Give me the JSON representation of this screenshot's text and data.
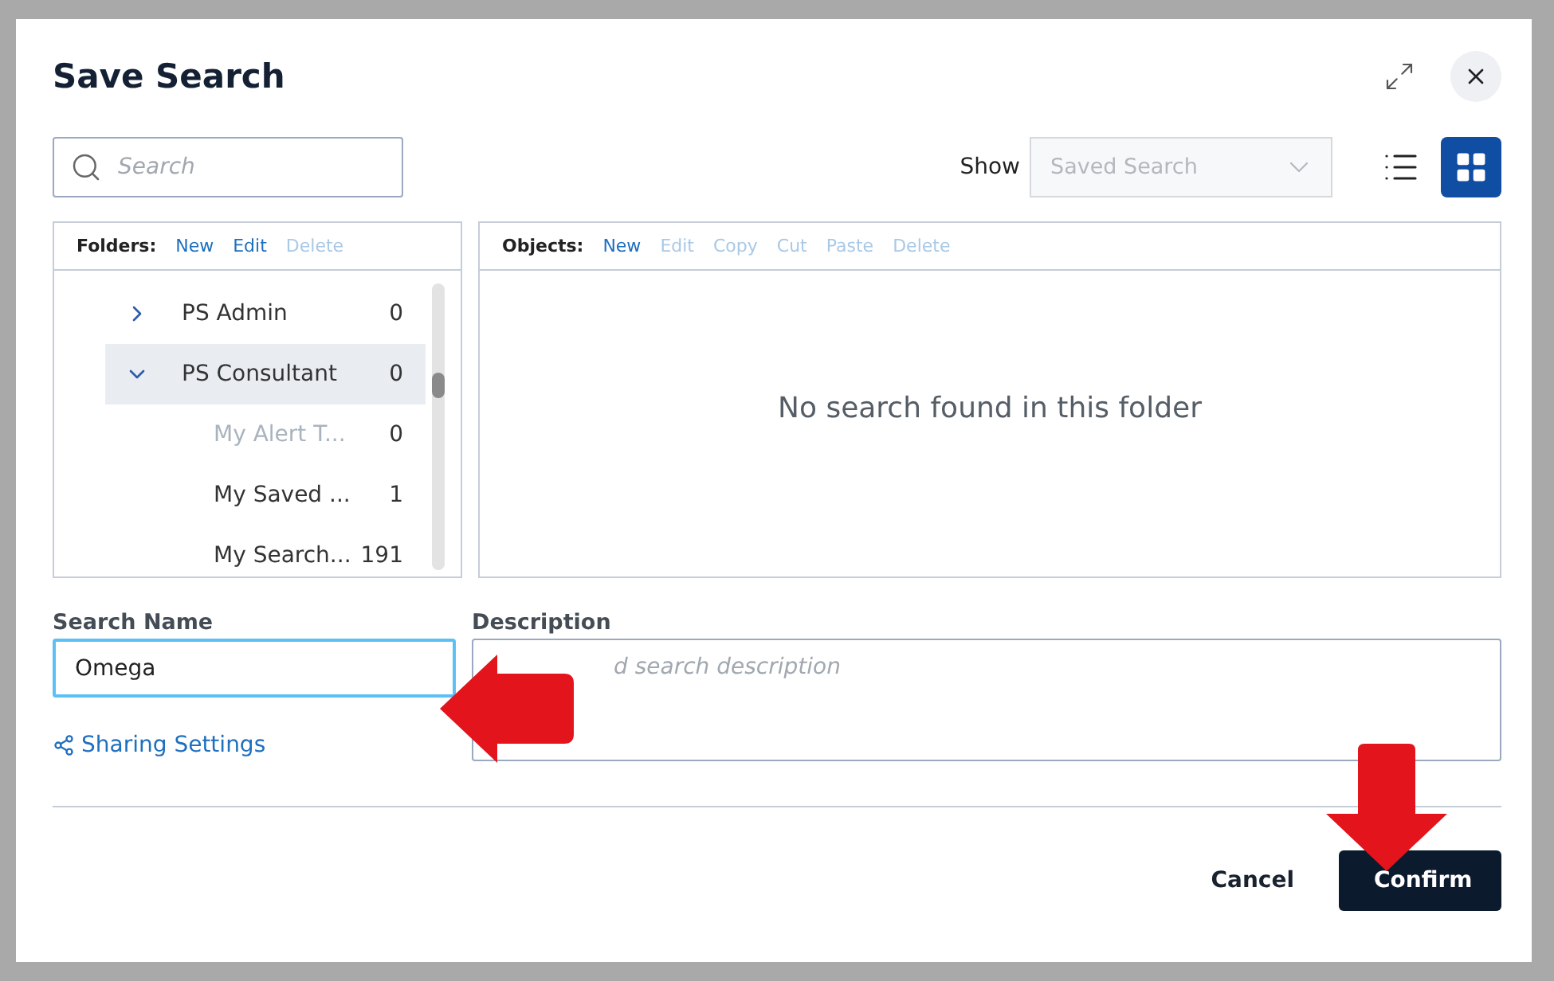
{
  "dialog": {
    "title": "Save Search"
  },
  "search": {
    "placeholder": "Search"
  },
  "show": {
    "label": "Show",
    "value": "Saved Search",
    "disabled": true
  },
  "view_buttons": [
    {
      "kind": "list",
      "selected": false
    },
    {
      "kind": "grid",
      "selected": true
    }
  ],
  "folders": {
    "label": "Folders:",
    "actions": [
      {
        "label": "New",
        "disabled": false
      },
      {
        "label": "Edit",
        "disabled": false
      },
      {
        "label": "Delete",
        "disabled": true
      }
    ],
    "tree": [
      {
        "label": "PS Admin",
        "count": "0",
        "expanded": false,
        "selected": false,
        "disabled": false
      },
      {
        "label": "PS Consultant",
        "count": "0",
        "expanded": true,
        "selected": true,
        "disabled": false,
        "children": [
          {
            "label": "My Alert T...",
            "count": "0",
            "selected": false,
            "disabled": true
          },
          {
            "label": "My Saved ...",
            "count": "1",
            "selected": false,
            "disabled": false
          },
          {
            "label": "My Search...",
            "count": "191",
            "selected": false,
            "disabled": false
          }
        ]
      }
    ]
  },
  "objects": {
    "label": "Objects:",
    "actions": [
      {
        "label": "New",
        "disabled": false
      },
      {
        "label": "Edit",
        "disabled": true
      },
      {
        "label": "Copy",
        "disabled": true
      },
      {
        "label": "Cut",
        "disabled": true
      },
      {
        "label": "Paste",
        "disabled": true
      },
      {
        "label": "Delete",
        "disabled": true
      }
    ],
    "empty_message": "No search found in this folder"
  },
  "search_name": {
    "label": "Search Name",
    "value": "Omega"
  },
  "description": {
    "label": "Description",
    "placeholder": "d search description"
  },
  "sharing_link": "Sharing Settings",
  "buttons": [
    {
      "label": "Cancel",
      "kind": "secondary"
    },
    {
      "label": "Confirm",
      "kind": "primary"
    }
  ]
}
